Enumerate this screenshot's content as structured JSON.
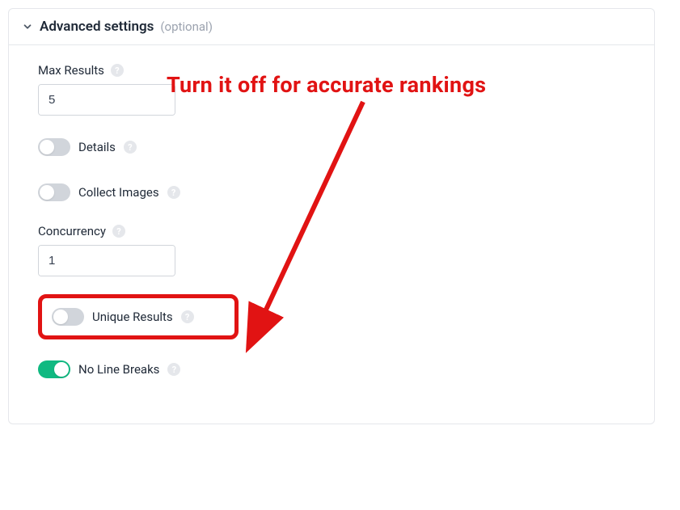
{
  "section": {
    "title": "Advanced settings",
    "subtitle": "(optional)"
  },
  "fields": {
    "maxResults": {
      "label": "Max Results",
      "value": "5"
    },
    "details": {
      "label": "Details",
      "on": false
    },
    "collectImages": {
      "label": "Collect Images",
      "on": false
    },
    "concurrency": {
      "label": "Concurrency",
      "value": "1"
    },
    "uniqueResults": {
      "label": "Unique Results",
      "on": false
    },
    "noLineBreaks": {
      "label": "No Line Breaks",
      "on": true
    }
  },
  "annotation": {
    "text": "Turn it off for accurate rankings",
    "color": "#e11313"
  },
  "icons": {
    "plus": "+",
    "minus": "−",
    "help": "?"
  }
}
